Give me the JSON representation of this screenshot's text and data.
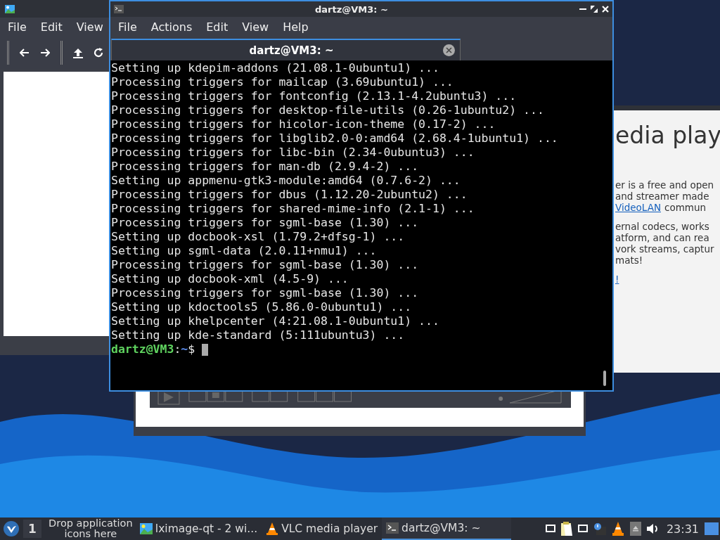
{
  "image_viewer": {
    "menu": [
      "File",
      "Edit",
      "View"
    ]
  },
  "vlc": {
    "heading": "edia play",
    "paragraphs": [
      [
        {
          "text": "er is a free and open"
        },
        {
          "text": "and streamer made"
        },
        {
          "link": "VideoLAN",
          "text": "commun"
        }
      ],
      [
        {
          "text": "ernal codecs, works"
        },
        {
          "text": "atform, and can rea"
        },
        {
          "text": "vork streams, captur"
        },
        {
          "text": "mats!"
        }
      ],
      [
        {
          "link": "!"
        }
      ]
    ]
  },
  "terminal": {
    "title": "dartz@VM3: ~",
    "menu": [
      "File",
      "Actions",
      "Edit",
      "View",
      "Help"
    ],
    "tab": {
      "label": "dartz@VM3: ~",
      "selected": true
    },
    "lines": [
      "Setting up kdepim-addons (21.08.1-0ubuntu1) ...",
      "Processing triggers for mailcap (3.69ubuntu1) ...",
      "Processing triggers for fontconfig (2.13.1-4.2ubuntu3) ...",
      "Processing triggers for desktop-file-utils (0.26-1ubuntu2) ...",
      "Processing triggers for hicolor-icon-theme (0.17-2) ...",
      "Processing triggers for libglib2.0-0:amd64 (2.68.4-1ubuntu1) ...",
      "Processing triggers for libc-bin (2.34-0ubuntu3) ...",
      "Processing triggers for man-db (2.9.4-2) ...",
      "Setting up appmenu-gtk3-module:amd64 (0.7.6-2) ...",
      "Processing triggers for dbus (1.12.20-2ubuntu2) ...",
      "Processing triggers for shared-mime-info (2.1-1) ...",
      "Processing triggers for sgml-base (1.30) ...",
      "Setting up docbook-xsl (1.79.2+dfsg-1) ...",
      "Setting up sgml-data (2.0.11+nmu1) ...",
      "Processing triggers for sgml-base (1.30) ...",
      "Setting up docbook-xml (4.5-9) ...",
      "Processing triggers for sgml-base (1.30) ...",
      "Setting up kdoctools5 (5.86.0-0ubuntu1) ...",
      "Setting up khelpcenter (4:21.08.1-0ubuntu1) ...",
      "Setting up kde-standard (5:111ubuntu3) ..."
    ],
    "prompt": {
      "user_host": "dartz@VM3",
      "separator": ":",
      "path": "~",
      "symbol": "$"
    }
  },
  "taskbar": {
    "workspace": "1",
    "quicklaunch": "Drop application icons here",
    "tasks": [
      {
        "kind": "image",
        "label": "lximage-qt - 2 wi...",
        "selected": false
      },
      {
        "kind": "vlc",
        "label": "VLC media player",
        "selected": false
      },
      {
        "kind": "terminal",
        "label": "dartz@VM3: ~",
        "selected": true
      }
    ],
    "clock": "23:31"
  }
}
